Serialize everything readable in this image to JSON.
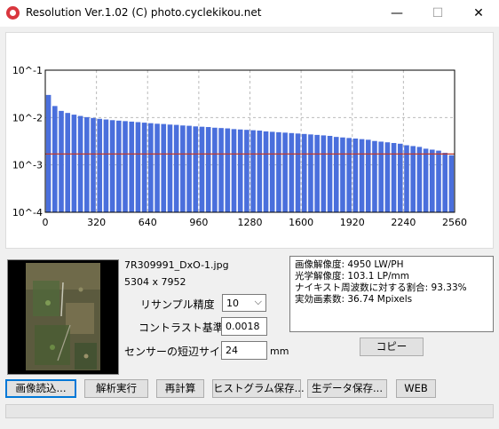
{
  "window": {
    "title": "Resolution Ver.1.02 (C) photo.cyclekikou.net",
    "min_glyph": "—",
    "max_glyph": "☐",
    "close_glyph": "✕"
  },
  "chart_data": {
    "type": "bar",
    "yscale": "log",
    "ylim": [
      0.0001,
      0.1
    ],
    "y_ticks": [
      "10^-1",
      "10^-2",
      "10^-3",
      "10^-4"
    ],
    "x_ticks": [
      "0",
      "320",
      "640",
      "960",
      "1280",
      "1600",
      "1920",
      "2240",
      "2560"
    ],
    "xlim": [
      0,
      2560
    ],
    "bar_color": "#4a6fdc",
    "threshold_color": "#c0392b",
    "threshold": 0.0017,
    "grid": true,
    "x": [
      20,
      60,
      100,
      140,
      180,
      220,
      260,
      300,
      340,
      380,
      420,
      460,
      500,
      540,
      580,
      620,
      660,
      700,
      740,
      780,
      820,
      860,
      900,
      940,
      980,
      1020,
      1060,
      1100,
      1140,
      1180,
      1220,
      1260,
      1300,
      1340,
      1380,
      1420,
      1460,
      1500,
      1540,
      1580,
      1620,
      1660,
      1700,
      1740,
      1780,
      1820,
      1860,
      1900,
      1940,
      1980,
      2020,
      2060,
      2100,
      2140,
      2180,
      2220,
      2260,
      2300,
      2340,
      2380,
      2420,
      2460,
      2500,
      2540
    ],
    "values": [
      0.03,
      0.0175,
      0.0138,
      0.0125,
      0.0115,
      0.0108,
      0.0102,
      0.0098,
      0.0094,
      0.0091,
      0.0088,
      0.0086,
      0.0084,
      0.0082,
      0.008,
      0.0078,
      0.0076,
      0.0074,
      0.0073,
      0.0071,
      0.007,
      0.0068,
      0.0067,
      0.0065,
      0.0064,
      0.0063,
      0.0061,
      0.006,
      0.0059,
      0.0057,
      0.0056,
      0.0055,
      0.0054,
      0.0053,
      0.0051,
      0.005,
      0.0049,
      0.0048,
      0.0047,
      0.0046,
      0.0045,
      0.0044,
      0.0043,
      0.0042,
      0.0041,
      0.0039,
      0.0038,
      0.0037,
      0.0036,
      0.0035,
      0.0034,
      0.0032,
      0.0031,
      0.003,
      0.0029,
      0.0028,
      0.0026,
      0.0025,
      0.0024,
      0.0022,
      0.0021,
      0.002,
      0.0018,
      0.0016
    ]
  },
  "image": {
    "filename": "7R309991_DxO-1.jpg",
    "dimensions": "5304 x 7952"
  },
  "settings": {
    "resample_label": "リサンプル精度",
    "resample_value": "10",
    "contrast_label": "コントラスト基準値",
    "contrast_value": "0.0018",
    "sensor_label": "センサーの短辺サイズ",
    "sensor_value": "24",
    "sensor_unit": "mm"
  },
  "results": {
    "line1": "画像解像度: 4950 LW/PH",
    "line2": "光学解像度: 103.1 LP/mm",
    "line3": "ナイキスト周波数に対する割合: 93.33%",
    "line4": "実効画素数: 36.74 Mpixels"
  },
  "buttons": {
    "copy": "コピー",
    "load": "画像読込...",
    "analyze": "解析実行",
    "recalc": "再計算",
    "save_hist": "ヒストグラム保存...",
    "save_raw": "生データ保存...",
    "web": "WEB"
  }
}
